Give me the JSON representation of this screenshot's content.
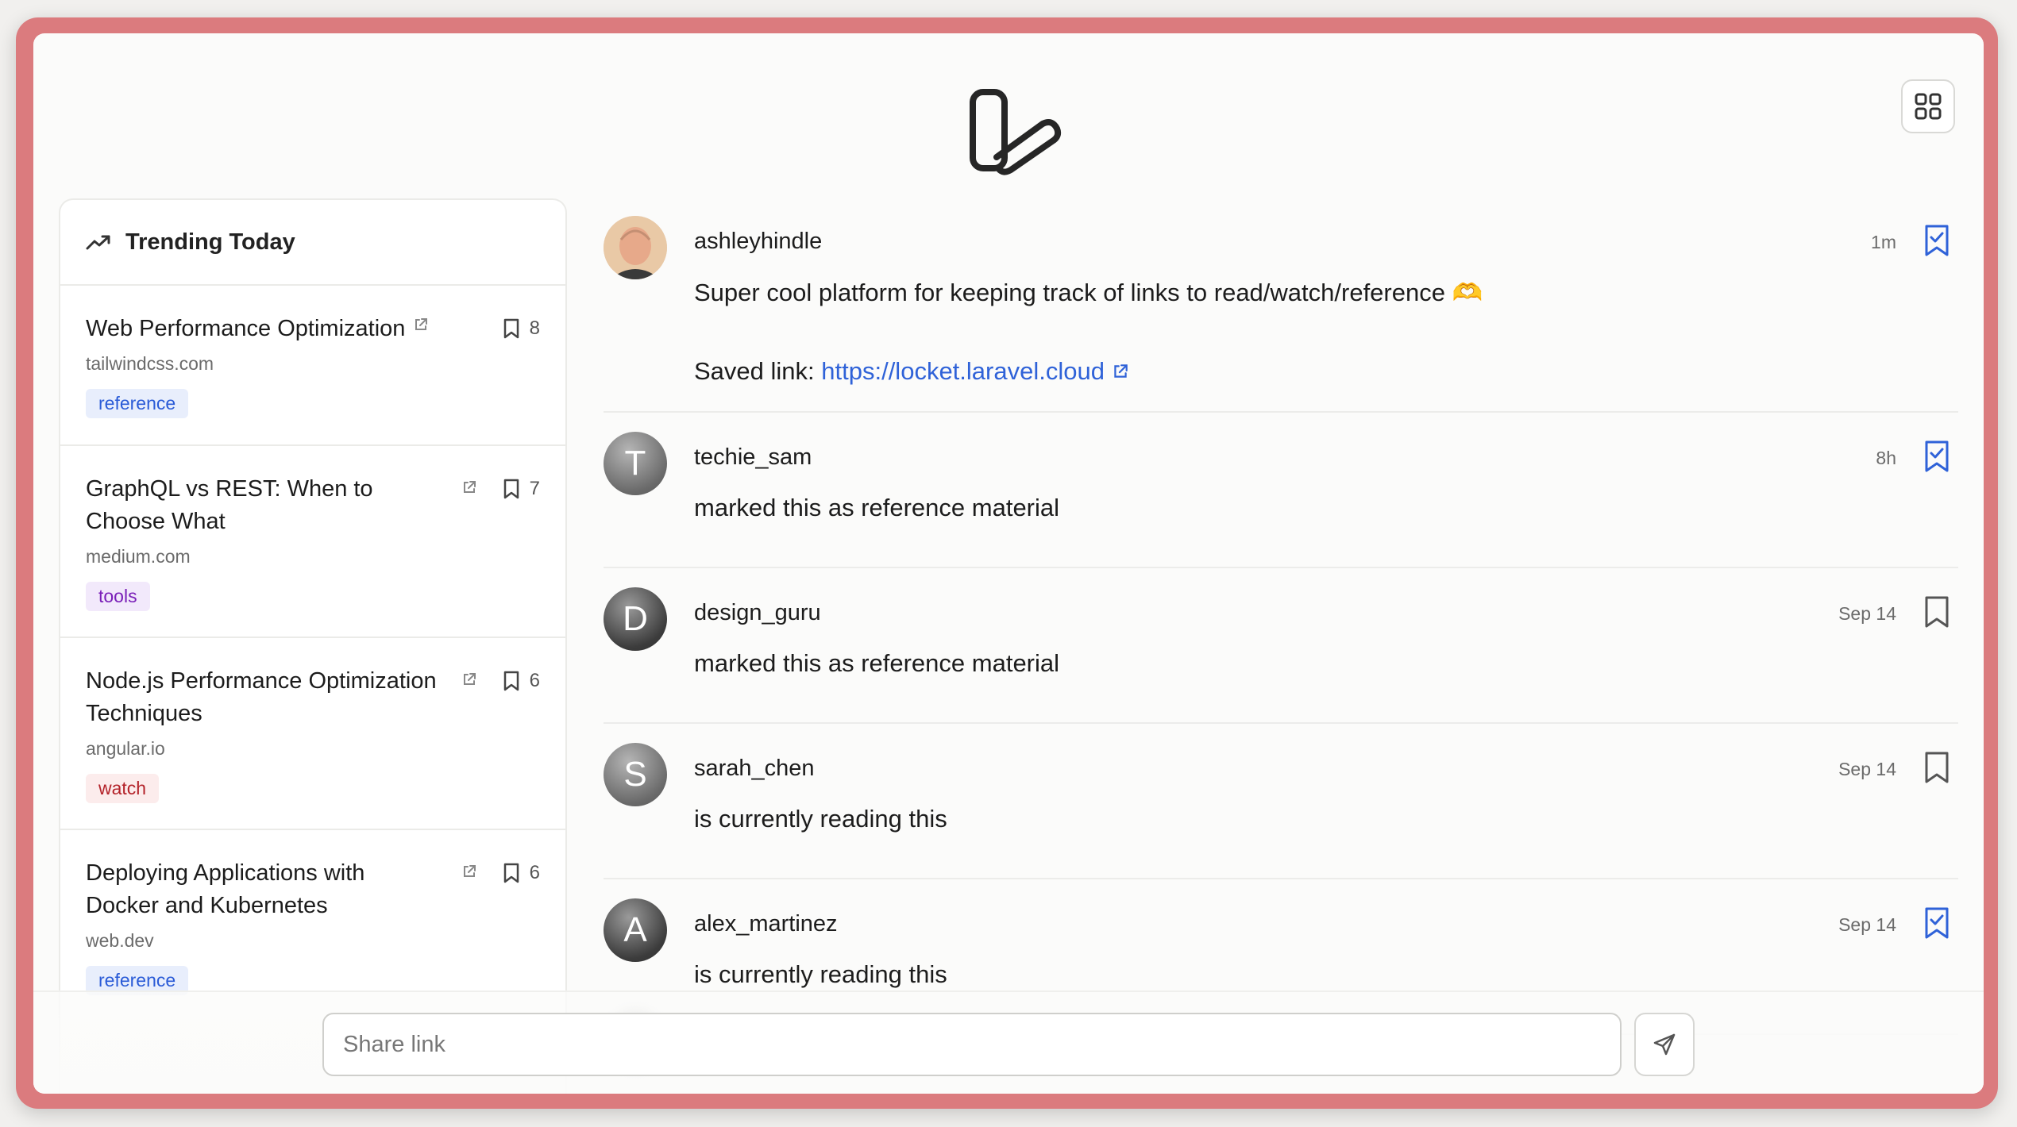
{
  "header": {
    "logo_icon": "locket-logo-icon",
    "apps_icon": "grid-icon"
  },
  "sidebar": {
    "title": "Trending Today",
    "title_icon": "trending-up-icon",
    "items": [
      {
        "title": "Web Performance Optimization",
        "domain": "tailwindcss.com",
        "tag": "reference",
        "count": "8"
      },
      {
        "title": "GraphQL vs REST: When to Choose What",
        "domain": "medium.com",
        "tag": "tools",
        "count": "7"
      },
      {
        "title": "Node.js Performance Optimization Techniques",
        "domain": "angular.io",
        "tag": "watch",
        "count": "6"
      },
      {
        "title": "Deploying Applications with Docker and Kubernetes",
        "domain": "web.dev",
        "tag": "reference",
        "count": "6"
      }
    ]
  },
  "feed": {
    "posts": [
      {
        "avatar": "photo",
        "user": "ashleyhindle",
        "text": "Super cool platform for keeping track of links to read/watch/reference 🫶",
        "saved_label": "Saved link:",
        "link": "https://locket.laravel.cloud",
        "time": "1m",
        "bookmarked": true
      },
      {
        "avatar": "T",
        "user": "techie_sam",
        "text": "marked this as reference material",
        "time": "8h",
        "bookmarked": true
      },
      {
        "avatar": "D",
        "user": "design_guru",
        "text": "marked this as reference material",
        "time": "Sep 14",
        "bookmarked": false
      },
      {
        "avatar": "S",
        "user": "sarah_chen",
        "text": "is currently reading this",
        "time": "Sep 14",
        "bookmarked": false
      },
      {
        "avatar": "A",
        "user": "alex_martinez",
        "text": "is currently reading this",
        "time": "Sep 14",
        "bookmarked": true
      }
    ]
  },
  "composer": {
    "placeholder": "Share link",
    "value": "",
    "send_icon": "send-icon"
  },
  "colors": {
    "frame": "#db7b7e",
    "accent": "#2f62d8",
    "reference_tag": "#2a5bd7",
    "tools_tag": "#7a1fb8",
    "watch_tag": "#b4232a"
  }
}
